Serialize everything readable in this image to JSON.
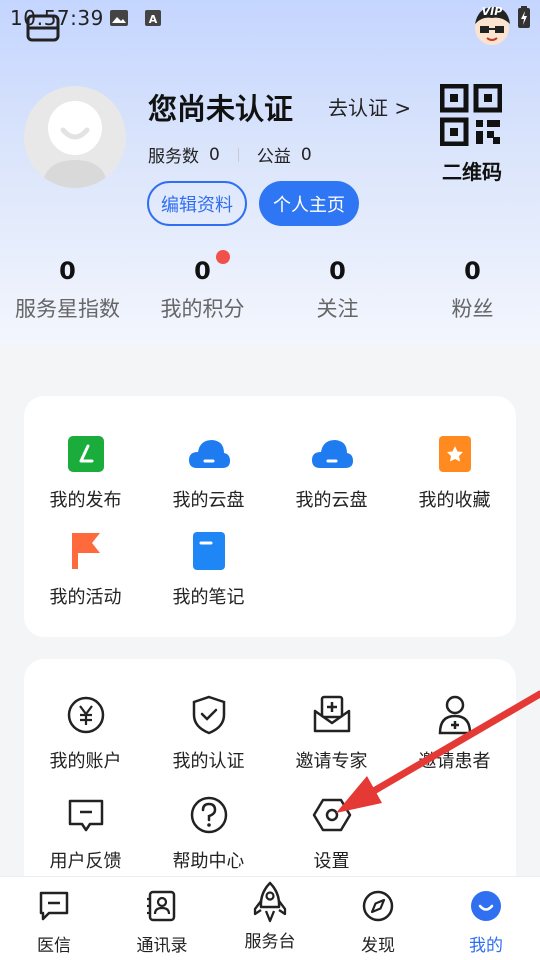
{
  "status_bar": {
    "time": "10:57:39"
  },
  "profile": {
    "name": "您尚未认证",
    "verify_link": "去认证 >",
    "services_label": "服务数",
    "services_count": "0",
    "charity_label": "公益",
    "charity_count": "0",
    "edit_button": "编辑资料",
    "homepage_button": "个人主页",
    "qr_label": "二维码",
    "vip_badge": "VIP"
  },
  "stats": [
    {
      "value": "0",
      "label": "服务星指数"
    },
    {
      "value": "0",
      "label": "我的积分"
    },
    {
      "value": "0",
      "label": "关注"
    },
    {
      "value": "0",
      "label": "粉丝"
    }
  ],
  "card1": {
    "items": [
      {
        "label": "我的发布",
        "icon": "publish-icon"
      },
      {
        "label": "我的云盘",
        "icon": "cloud-icon"
      },
      {
        "label": "我的云盘",
        "icon": "cloud-icon"
      },
      {
        "label": "我的收藏",
        "icon": "favorite-icon"
      },
      {
        "label": "我的活动",
        "icon": "flag-icon"
      },
      {
        "label": "我的笔记",
        "icon": "note-icon"
      }
    ]
  },
  "card2": {
    "items": [
      {
        "label": "我的账户",
        "icon": "yuan-icon"
      },
      {
        "label": "我的认证",
        "icon": "shield-icon"
      },
      {
        "label": "邀请专家",
        "icon": "invite-expert-icon"
      },
      {
        "label": "邀请患者",
        "icon": "invite-patient-icon"
      },
      {
        "label": "用户反馈",
        "icon": "feedback-icon"
      },
      {
        "label": "帮助中心",
        "icon": "help-icon"
      },
      {
        "label": "设置",
        "icon": "settings-icon"
      }
    ]
  },
  "nav": [
    {
      "label": "医信",
      "icon": "message-icon"
    },
    {
      "label": "通讯录",
      "icon": "contacts-icon"
    },
    {
      "label": "服务台",
      "icon": "rocket-icon"
    },
    {
      "label": "发现",
      "icon": "compass-icon"
    },
    {
      "label": "我的",
      "icon": "me-icon"
    }
  ],
  "colors": {
    "accent": "#2f6ff0",
    "green": "#1aad3c",
    "cloud_blue": "#1f7bf0",
    "orange": "#ff8a1f",
    "flag_orange": "#ff6a3d",
    "note_blue": "#1f86f5",
    "red_dot": "#f2504b",
    "arrow_red": "#e53935"
  }
}
